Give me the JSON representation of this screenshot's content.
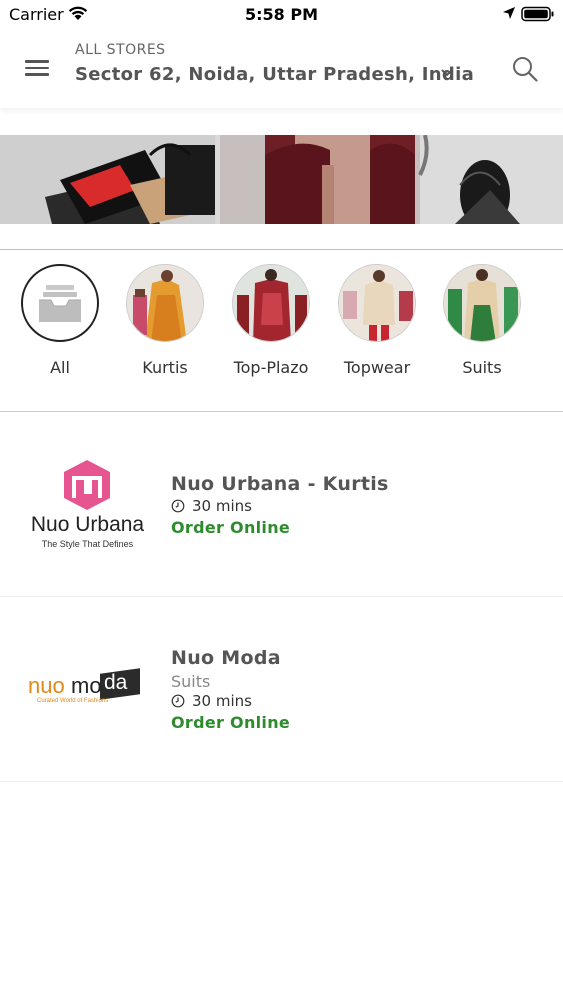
{
  "status_bar": {
    "carrier": "Carrier",
    "time": "5:58 PM"
  },
  "header": {
    "label": "ALL STORES",
    "location": "Sector 62, Noida, Uttar Pradesh, India",
    "icons": [
      "menu-icon",
      "chevron-down-icon",
      "search-icon"
    ]
  },
  "categories": [
    {
      "label": "All",
      "icon": "tray-icon"
    },
    {
      "label": "Kurtis"
    },
    {
      "label": "Top-Plazo"
    },
    {
      "label": "Topwear"
    },
    {
      "label": "Suits"
    }
  ],
  "stores": [
    {
      "name": "Nuo Urbana - Kurtis",
      "time": "30 mins",
      "action": "Order Online",
      "logo_text": "Nuo Urbana",
      "logo_tagline": "The Style That Defines"
    },
    {
      "name": "Nuo Moda",
      "category": "Suits",
      "time": "30 mins",
      "action": "Order Online",
      "logo_text_a": "nuo",
      "logo_text_b": "mo",
      "logo_text_c": "da",
      "logo_tagline": "Curated World of Fashions"
    }
  ],
  "colors": {
    "order_green": "#2e8b2e",
    "logo_pink": "#e6558f",
    "logo_orange": "#e08a1c"
  }
}
